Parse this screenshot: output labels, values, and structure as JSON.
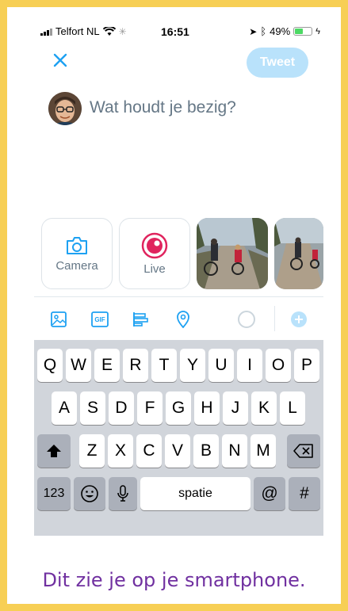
{
  "status_bar": {
    "carrier": "Telfort NL",
    "time": "16:51",
    "battery_percent": "49%",
    "battery_level": 0.49,
    "icons": [
      "signal-icon",
      "wifi-icon",
      "loading-icon",
      "location-arrow-icon",
      "bluetooth-icon",
      "battery-icon",
      "charging-icon"
    ]
  },
  "compose": {
    "close_icon": "close-icon",
    "tweet_label": "Tweet",
    "placeholder": "Wat houdt je bezig?"
  },
  "media": {
    "camera_label": "Camera",
    "live_label": "Live"
  },
  "toolbar": {
    "icons": [
      "image-icon",
      "gif-icon",
      "poll-icon",
      "location-pin-icon",
      "character-counter-icon",
      "add-thread-icon"
    ],
    "gif_text": "GIF"
  },
  "keyboard": {
    "row1": [
      "Q",
      "W",
      "E",
      "R",
      "T",
      "Y",
      "U",
      "I",
      "O",
      "P"
    ],
    "row2": [
      "A",
      "S",
      "D",
      "F",
      "G",
      "H",
      "J",
      "K",
      "L"
    ],
    "row3": [
      "Z",
      "X",
      "C",
      "V",
      "B",
      "N",
      "M"
    ],
    "numbers_label": "123",
    "space_label": "spatie",
    "at_label": "@",
    "hash_label": "#"
  },
  "caption": "Dit zie je op je smartphone.",
  "colors": {
    "frame": "#f7cf55",
    "accent": "#1da1f2",
    "live_red": "#e0245e",
    "caption": "#7030a0"
  }
}
